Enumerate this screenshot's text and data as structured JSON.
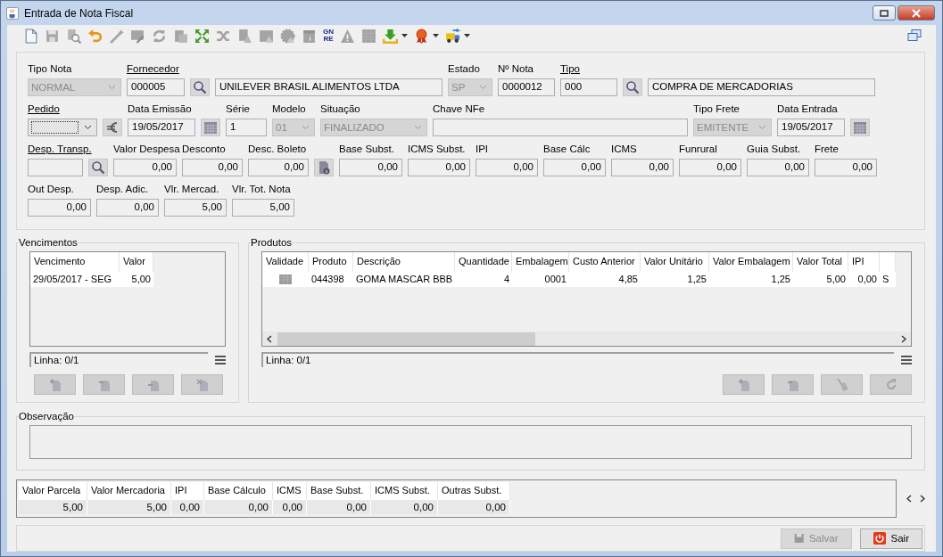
{
  "window": {
    "title": "Entrada de Nota Fiscal"
  },
  "toolbar": [
    {
      "disabled": false,
      "dropdown": false
    },
    {
      "disabled": true,
      "dropdown": false
    },
    {
      "disabled": true,
      "dropdown": false
    },
    {
      "disabled": false,
      "dropdown": false
    },
    {
      "disabled": true,
      "dropdown": false
    },
    {
      "disabled": true,
      "dropdown": false
    },
    {
      "disabled": true,
      "dropdown": false
    },
    {
      "disabled": true,
      "dropdown": false
    },
    {
      "disabled": false,
      "dropdown": false
    },
    {
      "disabled": true,
      "dropdown": false
    },
    {
      "disabled": true,
      "dropdown": false
    },
    {
      "disabled": true,
      "dropdown": false
    },
    {
      "disabled": true,
      "dropdown": false
    },
    {
      "disabled": true,
      "dropdown": false
    },
    {
      "disabled": false,
      "dropdown": false,
      "label": [
        "GN",
        "RE"
      ]
    },
    {
      "disabled": true,
      "dropdown": false
    },
    {
      "disabled": true,
      "dropdown": false
    },
    {
      "disabled": false,
      "dropdown": true
    },
    {
      "disabled": false,
      "dropdown": true
    },
    {
      "disabled": false,
      "dropdown": true
    }
  ],
  "form": {
    "rows": [
      {
        "fields": [
          {
            "kind": "combo",
            "label": "Tipo Nota",
            "linked": false,
            "value": "NORMAL",
            "disabled": true
          },
          {
            "kind": "text",
            "label": "Fornecedor",
            "linked": true,
            "value": "000005"
          },
          {
            "kind": "search"
          },
          {
            "kind": "text",
            "value": "UNILEVER BRASIL ALIMENTOS LTDA"
          },
          {
            "kind": "combo",
            "label": "Estado",
            "linked": false,
            "value": "SP",
            "disabled": true
          },
          {
            "kind": "text",
            "label": "Nº Nota",
            "linked": false,
            "value": "0000012"
          },
          {
            "kind": "text",
            "label": "Tipo",
            "linked": true,
            "value": "000"
          },
          {
            "kind": "search"
          },
          {
            "kind": "text",
            "value": "COMPRA DE MERCADORIAS"
          }
        ]
      },
      {
        "fields": [
          {
            "kind": "combo",
            "label": "Pedido",
            "linked": true,
            "disabled": false
          },
          {
            "kind": "euro"
          },
          {
            "kind": "text",
            "label": "Data Emissão",
            "linked": false,
            "value": "19/05/2017"
          },
          {
            "kind": "calendar"
          },
          {
            "kind": "text",
            "label": "Série",
            "linked": false,
            "value": "1"
          },
          {
            "kind": "combo",
            "label": "Modelo",
            "linked": false,
            "value": "01",
            "disabled": true
          },
          {
            "kind": "combo",
            "label": "Situação",
            "linked": false,
            "value": "FINALIZADO",
            "disabled": true
          },
          {
            "kind": "text",
            "label": "Chave NFe",
            "linked": false
          },
          {
            "kind": "combo",
            "label": "Tipo Frete",
            "linked": false,
            "value": "EMITENTE",
            "disabled": true
          },
          {
            "kind": "text",
            "label": "Data Entrada",
            "linked": false,
            "value": "19/05/2017"
          },
          {
            "kind": "calendar"
          }
        ]
      },
      {
        "fields": [
          {
            "kind": "text",
            "label": "Desp. Transp.",
            "linked": true
          },
          {
            "kind": "search"
          },
          {
            "kind": "number",
            "label": "Valor Despesa",
            "linked": false,
            "value": "0,00"
          },
          {
            "kind": "number",
            "label": "Desconto",
            "linked": false,
            "value": "0,00"
          },
          {
            "kind": "number",
            "label": "Desc. Boleto",
            "linked": false,
            "value": "0,00"
          },
          {
            "kind": "info"
          },
          {
            "kind": "number",
            "label": "Base Subst.",
            "linked": false,
            "value": "0,00"
          },
          {
            "kind": "number",
            "label": "ICMS Subst.",
            "linked": false,
            "value": "0,00"
          },
          {
            "kind": "number",
            "label": "IPI",
            "linked": false,
            "value": "0,00"
          },
          {
            "kind": "number",
            "label": "Base Cálc",
            "linked": false,
            "value": "0,00"
          },
          {
            "kind": "number",
            "label": "ICMS",
            "linked": false,
            "value": "0,00"
          },
          {
            "kind": "number",
            "label": "Funrural",
            "linked": false,
            "value": "0,00"
          },
          {
            "kind": "number",
            "label": "Guia Subst.",
            "linked": false,
            "value": "0,00"
          },
          {
            "kind": "number",
            "label": "Frete",
            "linked": false,
            "value": "0,00"
          }
        ]
      },
      {
        "fields": [
          {
            "kind": "number",
            "label": "Out Desp.",
            "linked": false,
            "value": "0,00"
          },
          {
            "kind": "number",
            "label": "Desp. Adic.",
            "linked": false,
            "value": "0,00"
          },
          {
            "kind": "number",
            "label": "Vlr. Mercad.",
            "linked": false,
            "value": "5,00"
          },
          {
            "kind": "number",
            "label": "Vlr. Tot. Nota",
            "linked": false,
            "value": "5,00"
          }
        ]
      }
    ]
  },
  "vencimentos": {
    "title": "Vencimentos",
    "columns": [
      "Vencimento",
      "Valor"
    ],
    "rows": [
      [
        "29/05/2017 - SEG",
        "5,00"
      ]
    ],
    "status": "Linha: 0/1",
    "buttons": [
      {
        "disabled": true
      },
      {
        "disabled": true
      },
      {
        "disabled": true
      },
      {
        "disabled": true
      }
    ]
  },
  "produtos": {
    "title": "Produtos",
    "columns": [
      "Validade",
      "Produto",
      "Descrição",
      "Quantidade",
      "Embalagem",
      "Custo Anterior",
      "Valor Unitário",
      "Valor Embalagem",
      "Valor Total",
      "IPI"
    ],
    "rows": [
      [
        "",
        "044398",
        "GOMA MASCAR BBB",
        "4",
        "0001",
        "4,85",
        "1,25",
        "1,25",
        "5,00",
        "0,00",
        "S"
      ]
    ],
    "status": "Linha: 0/1",
    "buttons": [
      {
        "disabled": true
      },
      {
        "disabled": true
      },
      {
        "disabled": true
      },
      {
        "disabled": true
      }
    ]
  },
  "observacao": {
    "title": "Observação"
  },
  "totals": {
    "columns": [
      "Valor Parcela",
      "Valor Mercadoria",
      "IPI",
      "Base Cálculo",
      "ICMS",
      "Base Subst.",
      "ICMS Subst.",
      "Outras Subst."
    ],
    "values": [
      "5,00",
      "5,00",
      "0,00",
      "0,00",
      "0,00",
      "0,00",
      "0,00",
      "0,00"
    ]
  },
  "actions": [
    {
      "label": "Salvar",
      "disabled": true
    },
    {
      "label": "Sair",
      "disabled": false
    }
  ]
}
